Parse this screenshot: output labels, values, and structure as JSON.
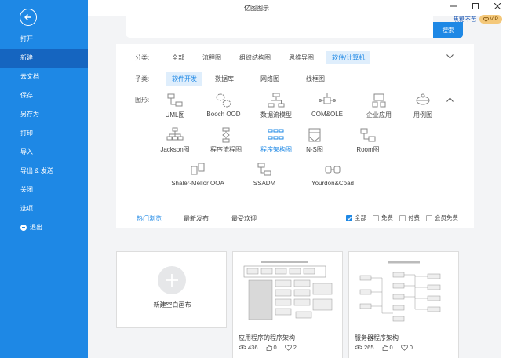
{
  "app": {
    "title": "亿图图示"
  },
  "vip": {
    "text": "焦糖不苦",
    "badge": "VIP"
  },
  "sidebar": {
    "items": [
      {
        "label": "打开"
      },
      {
        "label": "新建"
      },
      {
        "label": "云文档"
      },
      {
        "label": "保存"
      },
      {
        "label": "另存为"
      },
      {
        "label": "打印"
      },
      {
        "label": "导入"
      },
      {
        "label": "导出 & 发送"
      },
      {
        "label": "关闭"
      },
      {
        "label": "选项"
      },
      {
        "label": "退出"
      }
    ]
  },
  "search": {
    "placeholder": "",
    "button_label": "搜索"
  },
  "filters": {
    "category_label": "分类:",
    "categories": [
      "全部",
      "流程图",
      "组织结构图",
      "思维导图",
      "软件/计算机"
    ],
    "subcategory_label": "子类:",
    "subcategories": [
      "软件开发",
      "数据库",
      "网络图",
      "线框图"
    ],
    "shapes_label": "图形:",
    "shapes": [
      {
        "label": "UML图",
        "icon": "uml-icon"
      },
      {
        "label": "Booch OOD",
        "icon": "booch-icon"
      },
      {
        "label": "数据流模型",
        "icon": "data-flow-icon"
      },
      {
        "label": "COM&OLE",
        "icon": "com-ole-icon"
      },
      {
        "label": "企业应用",
        "icon": "enterprise-app-icon"
      },
      {
        "label": "用例图",
        "icon": "use-case-icon"
      },
      {
        "label": "Jackson图",
        "icon": "jackson-icon"
      },
      {
        "label": "程序流程图",
        "icon": "program-flow-icon"
      },
      {
        "label": "程序架构图",
        "icon": "program-architecture-icon"
      },
      {
        "label": "N-S图",
        "icon": "ns-diagram-icon"
      },
      {
        "label": "Room图",
        "icon": "room-diagram-icon"
      },
      {
        "label": "Shaler-Mellor OOA",
        "icon": "shaler-mellor-icon"
      },
      {
        "label": "SSADM",
        "icon": "ssadm-icon"
      },
      {
        "label": "Yourdon&Coad",
        "icon": "yourdon-coad-icon"
      }
    ]
  },
  "tabs": [
    "热门浏览",
    "最新发布",
    "最受欢迎"
  ],
  "price_filters": [
    "全部",
    "免费",
    "付费",
    "会员免费"
  ],
  "cards": {
    "new_blank": "新建空白画布",
    "templates": [
      {
        "title": "应用程序的程序架构",
        "views": "436",
        "likes": "0",
        "favorites": "2"
      },
      {
        "title": "服务器程序架构",
        "views": "265",
        "likes": "0",
        "favorites": "0"
      }
    ]
  },
  "colors": {
    "accent": "#1e88e5",
    "sidebar_active": "#1565c0"
  }
}
